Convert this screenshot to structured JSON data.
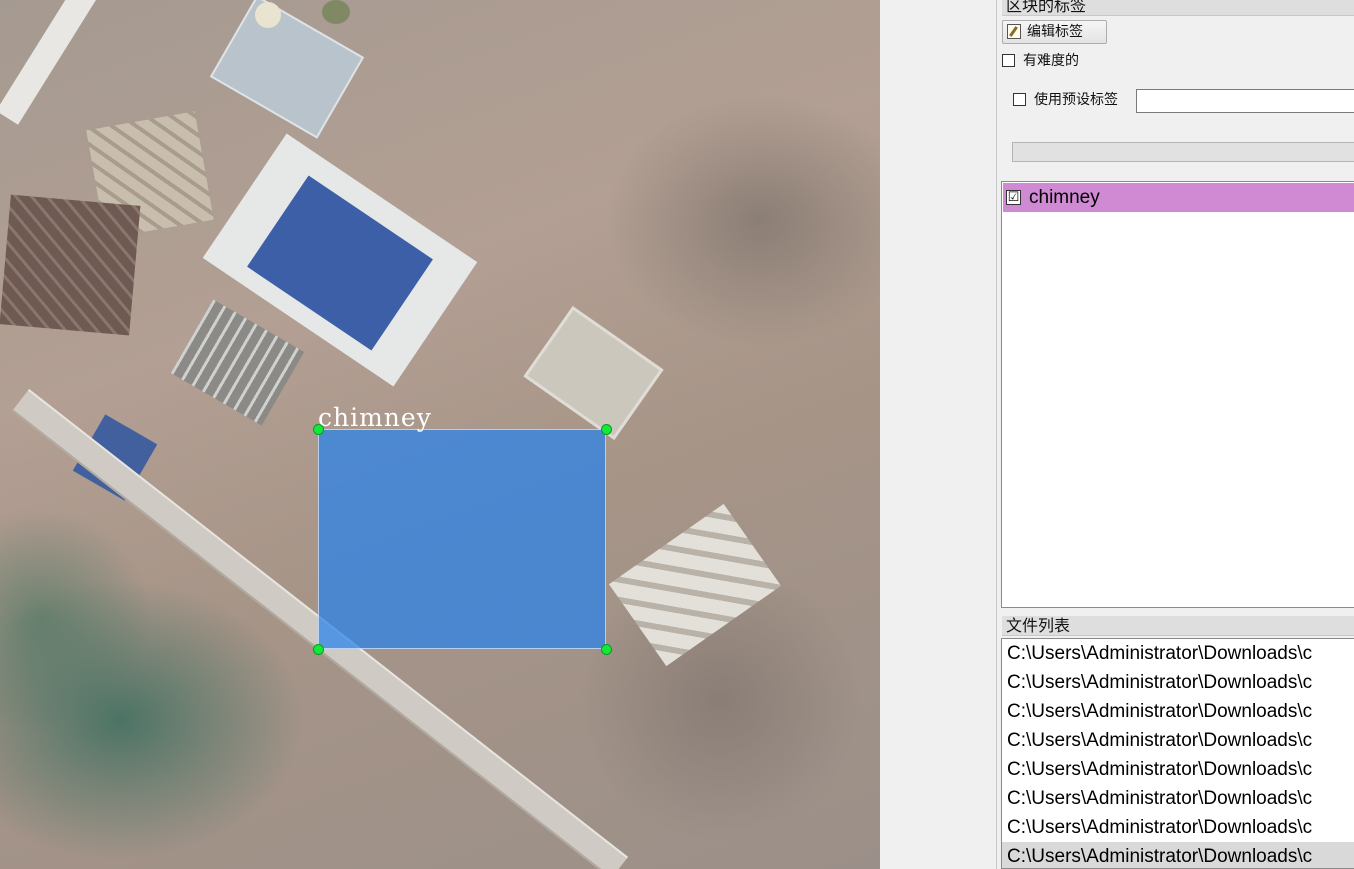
{
  "canvas": {
    "box_label": "chimney",
    "box_color": "#2882eb",
    "handle_color": "#14e83a"
  },
  "panel": {
    "box_labels_title": "区块的标签",
    "edit_label_button": "编辑标签",
    "difficult_label": "有难度的",
    "use_preset_label": "使用预设标签",
    "preset_value": "",
    "labels": [
      {
        "text": "chimney",
        "checked": true,
        "color": "#cf8ad3"
      }
    ],
    "file_list_title": "文件列表",
    "files": [
      "C:\\Users\\Administrator\\Downloads\\c",
      "C:\\Users\\Administrator\\Downloads\\c",
      "C:\\Users\\Administrator\\Downloads\\c",
      "C:\\Users\\Administrator\\Downloads\\c",
      "C:\\Users\\Administrator\\Downloads\\c",
      "C:\\Users\\Administrator\\Downloads\\c",
      "C:\\Users\\Administrator\\Downloads\\c",
      "C:\\Users\\Administrator\\Downloads\\c"
    ],
    "selected_file_index": 7
  }
}
